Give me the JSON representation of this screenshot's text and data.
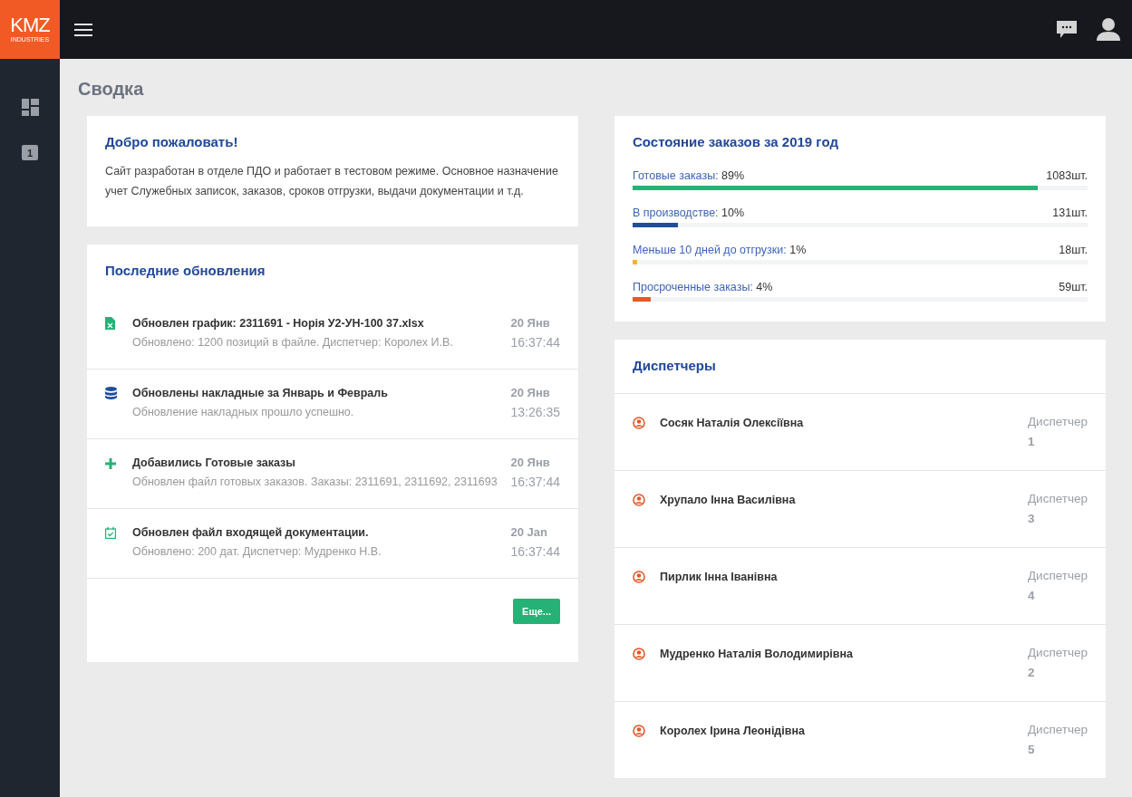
{
  "logo": {
    "title": "KMZ",
    "subtitle": "INDUSTRIES"
  },
  "sidebar": {
    "badge": "1"
  },
  "page_title": "Сводка",
  "welcome": {
    "title": "Добро пожаловать!",
    "text": "Сайт разработан в отделе ПДО и работает в тестовом режиме. Основное назначение учет Служебных записок, заказов, сроков отгрузки, выдачи документации и т.д."
  },
  "updates": {
    "title": "Последние обновления",
    "items": [
      {
        "kind": "excel",
        "title": "Обновлен график: 2311691 - Норія У2-УН-100 37.xlsx",
        "text": "Обновлено: 1200 позиций в файле. Диспетчер: Королех И.В.",
        "date": "20 Янв",
        "time": "16:37:44"
      },
      {
        "kind": "database",
        "title": "Обновлены накладные за Январь и Февраль",
        "text": "Обновление накладных прошло успешно.",
        "date": "20 Янв",
        "time": "13:26:35"
      },
      {
        "kind": "plus",
        "title": "Добавились Готовые заказы",
        "text": "Обновлен файл готовых заказов. Заказы: 2311691, 2311692, 2311693",
        "date": "20 Янв",
        "time": "16:37:44"
      },
      {
        "kind": "calendar",
        "title": "Обновлен файл входящей документации.",
        "text": "Обновлено: 200 дат. Диспетчер: Мудренко Н.В.",
        "date": "20 Jan",
        "time": "16:37:44"
      }
    ],
    "more_button": "Еще..."
  },
  "orders": {
    "title": "Состояние заказов за 2019 год",
    "items": [
      {
        "label": "Готовые заказы:",
        "percent": "89%",
        "count": "1083шт.",
        "level": 0.89,
        "color": "#26b176"
      },
      {
        "label": "В производстве:",
        "percent": "10%",
        "count": "131шт.",
        "level": 0.1,
        "color": "#1f4e9c"
      },
      {
        "label": "Меньше 10 дней до отгрузки:",
        "percent": "1%",
        "count": "18шт.",
        "level": 0.01,
        "color": "#f7b32b"
      },
      {
        "label": "Просроченные заказы:",
        "percent": "4%",
        "count": "59шт.",
        "level": 0.04,
        "color": "#e05a2b"
      }
    ]
  },
  "dispatchers": {
    "title": "Диспетчеры",
    "items": [
      {
        "name": "Сосяк Наталія Олексіївна",
        "role": "Диспетчер",
        "number": "1"
      },
      {
        "name": "Хрупало Інна Василівна",
        "role": "Диспетчер",
        "number": "3"
      },
      {
        "name": "Пирлик Інна Іванівна",
        "role": "Диспетчер",
        "number": "4"
      },
      {
        "name": "Мудренко Наталія Володимирівна",
        "role": "Диспетчер",
        "number": "2"
      },
      {
        "name": "Королех Ірина Леонідівна",
        "role": "Диспетчер",
        "number": "5"
      }
    ]
  }
}
